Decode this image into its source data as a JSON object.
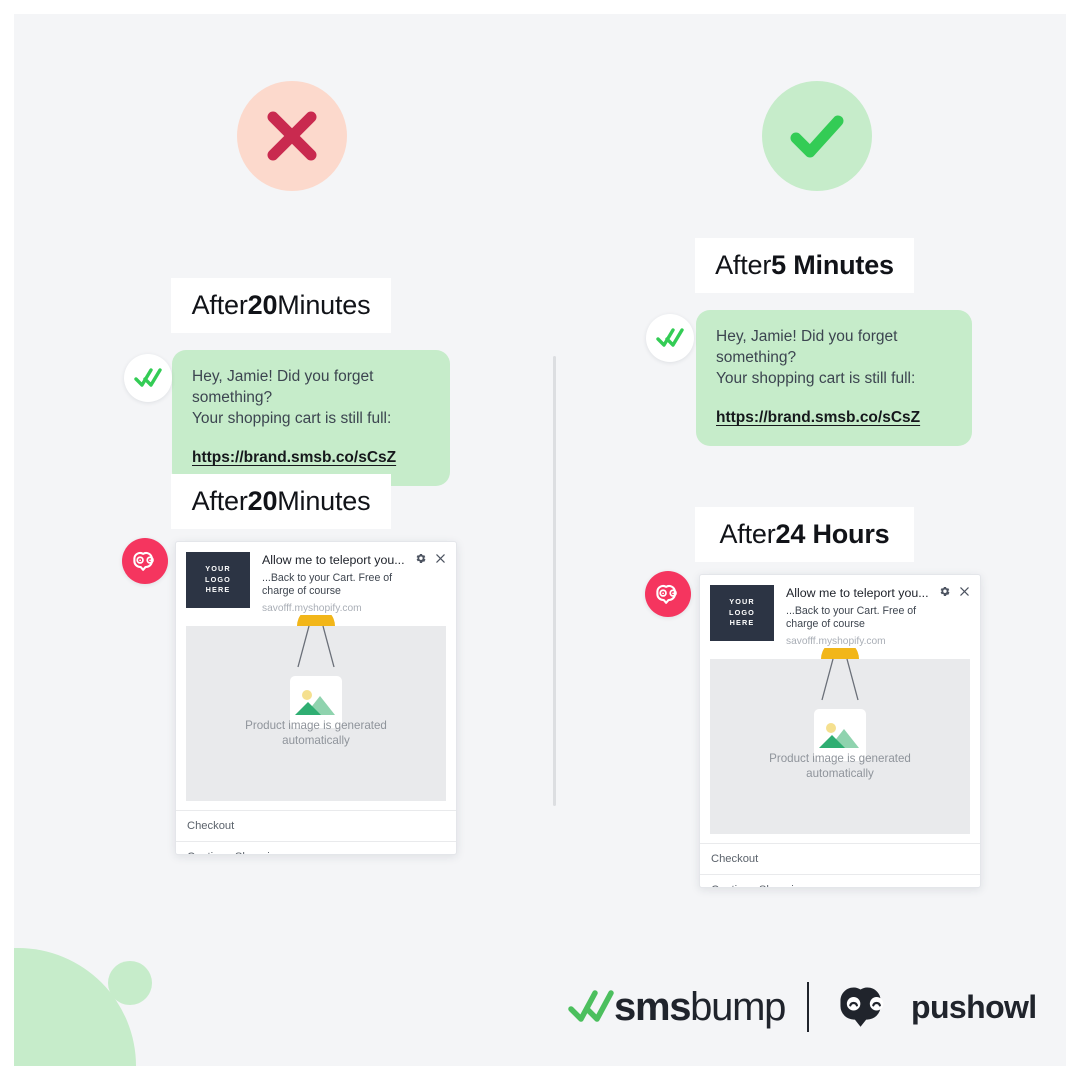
{
  "canvas": {
    "background": "#f4f5f7",
    "accent_green": "#c6ecca",
    "accent_red_bg": "#fcd9cc",
    "accent_red": "#c92a4f",
    "accent_check_green": "#33cc55",
    "owl_pink": "#f5355f",
    "dark": "#2c3444"
  },
  "status": {
    "bad": {
      "icon": "cross-icon",
      "label": "Bad example"
    },
    "good": {
      "icon": "check-icon",
      "label": "Good example"
    }
  },
  "left_column": {
    "sms": {
      "caption_prefix": "After ",
      "caption_value": "20",
      "caption_suffix": " Minutes",
      "avatar_icon": "double-check-icon",
      "line1": "Hey, Jamie! Did you forget something?",
      "line2": "Your shopping cart is still full:",
      "link": "https://brand.smsb.co/sCsZ"
    },
    "push": {
      "caption_prefix": "After ",
      "caption_value": "20",
      "caption_suffix": " Minutes",
      "avatar_icon": "owl-icon",
      "logo_line1": "YOUR",
      "logo_line2": "LOGO",
      "logo_line3": "HERE",
      "title": "Allow me to teleport you...",
      "body": "...Back to your Cart. Free of charge of course",
      "domain": "savofff.myshopify.com",
      "media_caption_line1": "Product image is generated",
      "media_caption_line2": "automatically",
      "action_checkout": "Checkout",
      "action_continue": "Continue Shopping",
      "gear_icon": "gear-icon",
      "close_icon": "close-icon"
    }
  },
  "right_column": {
    "sms": {
      "caption_prefix": "After ",
      "caption_value": "5 Minutes",
      "caption_suffix": "",
      "avatar_icon": "double-check-icon",
      "line1": "Hey, Jamie! Did you forget something?",
      "line2": "Your shopping cart is still full:",
      "link": "https://brand.smsb.co/sCsZ"
    },
    "push": {
      "caption_prefix": "After ",
      "caption_value": "24 Hours",
      "caption_suffix": "",
      "avatar_icon": "owl-icon",
      "logo_line1": "YOUR",
      "logo_line2": "LOGO",
      "logo_line3": "HERE",
      "title": "Allow me to teleport you...",
      "body": "...Back to your Cart. Free of charge of course",
      "domain": "savofff.myshopify.com",
      "media_caption_line1": "Product image is generated",
      "media_caption_line2": "automatically",
      "action_checkout": "Checkout",
      "action_continue": "Continue Shopping",
      "gear_icon": "gear-icon",
      "close_icon": "close-icon"
    }
  },
  "footer": {
    "smsbump_bold": "sms",
    "smsbump_light": "bump",
    "pushowl": "pushowl",
    "smsbump_icon": "double-check-icon",
    "pushowl_icon": "owl-icon"
  }
}
